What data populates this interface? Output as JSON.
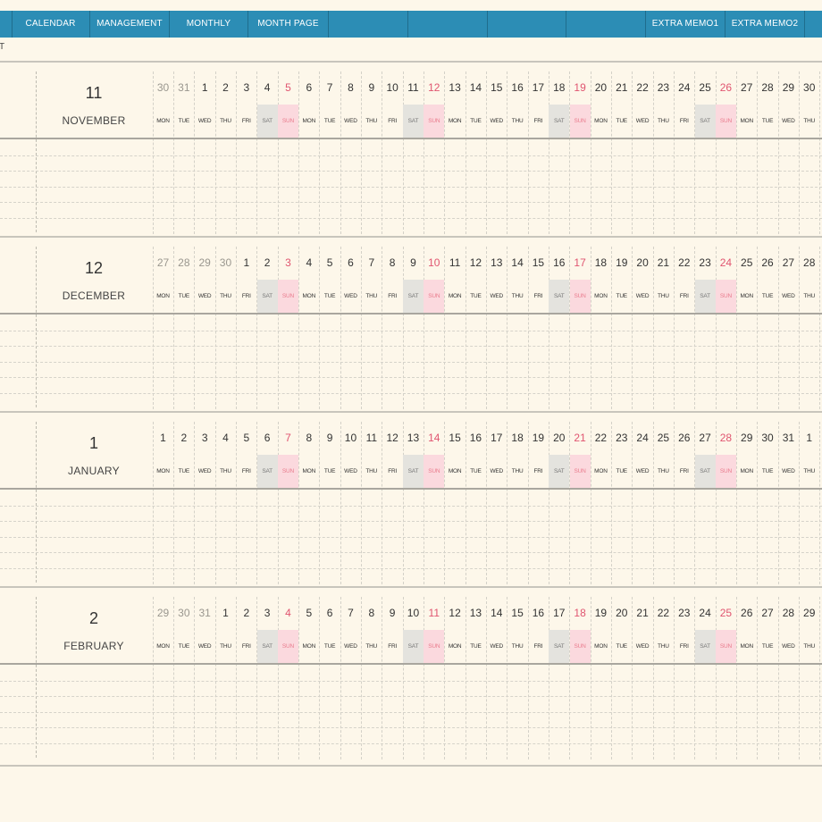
{
  "tabs": [
    {
      "label": "CALENDAR"
    },
    {
      "label": "MANAGEMENT"
    },
    {
      "label": "MONTHLY"
    },
    {
      "label": "MONTH PAGE"
    },
    {
      "label": ""
    },
    {
      "label": ""
    },
    {
      "label": ""
    },
    {
      "label": ""
    },
    {
      "label": "EXTRA MEMO1"
    },
    {
      "label": "EXTRA MEMO2"
    },
    {
      "label": ""
    }
  ],
  "header_truncated_text": "T",
  "colors": {
    "tabbar": "#2c8db5",
    "background": "#fdf7ea",
    "sunday": "#e05570",
    "sunday_fill": "#fbd9de",
    "saturday_fill": "#e4e3de"
  },
  "months": [
    {
      "number": "11",
      "name": "NOVEMBER",
      "days": [
        "30",
        "31",
        "1",
        "2",
        "3",
        "4",
        "5",
        "6",
        "7",
        "8",
        "9",
        "10",
        "11",
        "12",
        "13",
        "14",
        "15",
        "16",
        "17",
        "18",
        "19",
        "20",
        "21",
        "22",
        "23",
        "24",
        "25",
        "26",
        "27",
        "28",
        "29",
        "30"
      ],
      "prefix_other_month": 2
    },
    {
      "number": "12",
      "name": "DECEMBER",
      "days": [
        "27",
        "28",
        "29",
        "30",
        "1",
        "2",
        "3",
        "4",
        "5",
        "6",
        "7",
        "8",
        "9",
        "10",
        "11",
        "12",
        "13",
        "14",
        "15",
        "16",
        "17",
        "18",
        "19",
        "20",
        "21",
        "22",
        "23",
        "24",
        "25",
        "26",
        "27",
        "28"
      ],
      "prefix_other_month": 4
    },
    {
      "number": "1",
      "name": "JANUARY",
      "days": [
        "1",
        "2",
        "3",
        "4",
        "5",
        "6",
        "7",
        "8",
        "9",
        "10",
        "11",
        "12",
        "13",
        "14",
        "15",
        "16",
        "17",
        "18",
        "19",
        "20",
        "21",
        "22",
        "23",
        "24",
        "25",
        "26",
        "27",
        "28",
        "29",
        "30",
        "31",
        "1"
      ],
      "prefix_other_month": 0
    },
    {
      "number": "2",
      "name": "FEBRUARY",
      "days": [
        "29",
        "30",
        "31",
        "1",
        "2",
        "3",
        "4",
        "5",
        "6",
        "7",
        "8",
        "9",
        "10",
        "11",
        "12",
        "13",
        "14",
        "15",
        "16",
        "17",
        "18",
        "19",
        "20",
        "21",
        "22",
        "23",
        "24",
        "25",
        "26",
        "27",
        "28",
        "29"
      ],
      "prefix_other_month": 3
    }
  ],
  "weekdays": [
    "MON",
    "TUE",
    "WED",
    "THU",
    "FRI",
    "SAT",
    "SUN"
  ]
}
